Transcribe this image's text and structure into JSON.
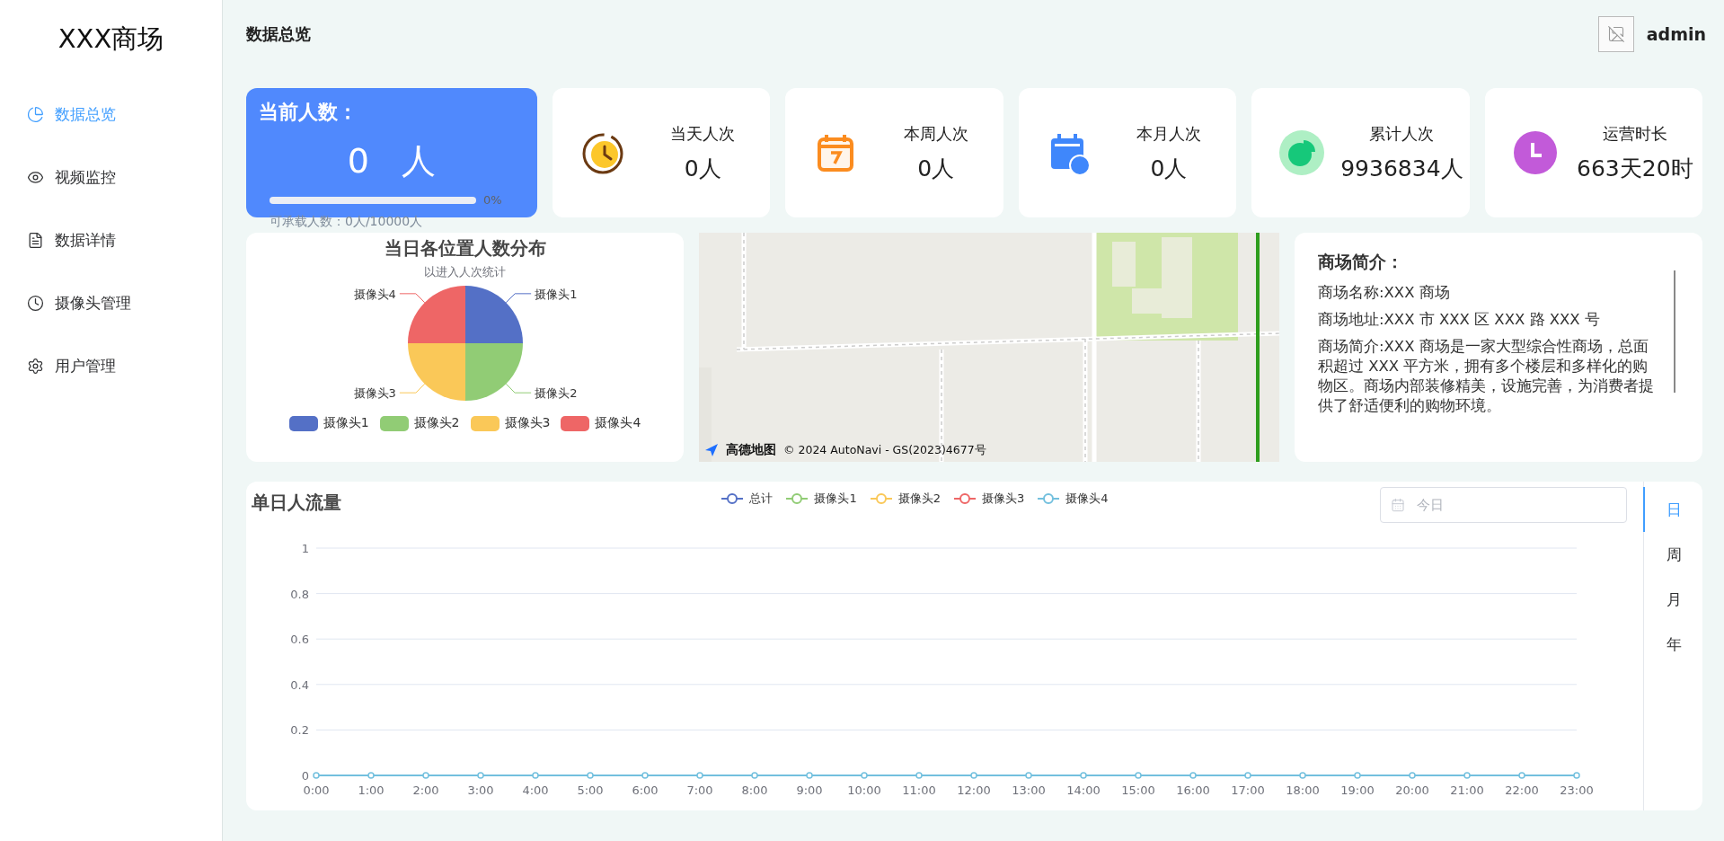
{
  "sidebar": {
    "logo": "XXX商场",
    "items": [
      {
        "label": "数据总览",
        "selected": true
      },
      {
        "label": "视频监控",
        "selected": false
      },
      {
        "label": "数据详情",
        "selected": false
      },
      {
        "label": "摄像头管理",
        "selected": false
      },
      {
        "label": "用户管理",
        "selected": false
      }
    ]
  },
  "header": {
    "title": "数据总览",
    "user": "admin"
  },
  "current": {
    "title": "当前人数：",
    "count": "0 人",
    "level": 0,
    "percent": "0%",
    "capacity": "可承载人数：0人/10000人"
  },
  "stats": [
    {
      "label": "当天人次",
      "value": "0人"
    },
    {
      "label": "本周人次",
      "value": "0人"
    },
    {
      "label": "本月人次",
      "value": "0人"
    },
    {
      "label": "累计人次",
      "value": "9936834人"
    },
    {
      "label": "运营时长",
      "value": "663天20时"
    }
  ],
  "distribution": {
    "subtitle": "以进入人次统计",
    "chart_data": {
      "type": "pie",
      "title": "当日各位置人数分布",
      "categories": [
        "摄像头1",
        "摄像头2",
        "摄像头3",
        "摄像头4"
      ],
      "values": [
        1,
        1,
        1,
        1
      ],
      "colors": [
        "#5470c6",
        "#91cc75",
        "#fac858",
        "#ee6666"
      ]
    }
  },
  "map": {
    "brand": "高德地图",
    "attribution": "© 2024 AutoNavi - GS(2023)4677号"
  },
  "intro": {
    "title": "商场简介：",
    "paragraphs": [
      "商场名称:XXX 商场",
      "商场地址:XXX 市 XXX 区 XXX 路 XXX 号",
      "商场简介:XXX 商场是一家大型综合性商场，总面积超过 XXX 平方米，拥有多个楼层和多样化的购物区。商场内部装修精美，设施完善，为消费者提供了舒适便利的购物环境。"
    ]
  },
  "traffic": {
    "title": "单日人流量",
    "date_field": {
      "placeholder": "今日"
    },
    "chart_data": {
      "type": "line",
      "x": [
        "0:00",
        "1:00",
        "2:00",
        "3:00",
        "4:00",
        "5:00",
        "6:00",
        "7:00",
        "8:00",
        "9:00",
        "10:00",
        "11:00",
        "12:00",
        "13:00",
        "14:00",
        "15:00",
        "16:00",
        "17:00",
        "18:00",
        "19:00",
        "20:00",
        "21:00",
        "22:00",
        "23:00"
      ],
      "ylim": [
        0,
        1
      ],
      "grid": true,
      "yticks": [
        0,
        0.2,
        0.4,
        0.6,
        0.8,
        1
      ],
      "series": [
        {
          "name": "总计",
          "color": "#5470c6",
          "marker": true,
          "values": [
            null,
            null,
            null,
            null,
            null,
            null,
            null,
            null,
            null,
            null,
            null,
            null,
            null,
            null,
            null,
            null,
            null,
            null,
            null,
            null,
            null,
            null,
            null,
            null
          ]
        },
        {
          "name": "摄像头1",
          "color": "#91cc75",
          "marker": true,
          "values": [
            null,
            null,
            null,
            null,
            null,
            null,
            null,
            null,
            null,
            null,
            null,
            null,
            null,
            null,
            null,
            null,
            null,
            null,
            null,
            null,
            null,
            null,
            null,
            null
          ]
        },
        {
          "name": "摄像头2",
          "color": "#fac858",
          "marker": true,
          "values": [
            null,
            null,
            null,
            null,
            null,
            null,
            null,
            null,
            null,
            null,
            null,
            null,
            null,
            null,
            null,
            null,
            null,
            null,
            null,
            null,
            null,
            null,
            null,
            null
          ]
        },
        {
          "name": "摄像头3",
          "color": "#ee6666",
          "marker": true,
          "values": [
            null,
            null,
            null,
            null,
            null,
            null,
            null,
            null,
            null,
            null,
            null,
            null,
            null,
            null,
            null,
            null,
            null,
            null,
            null,
            null,
            null,
            null,
            null,
            null
          ]
        },
        {
          "name": "摄像头4",
          "color": "#73c0de",
          "marker": true,
          "values": [
            0,
            0,
            0,
            0,
            0,
            0,
            0,
            0,
            0,
            0,
            0,
            0,
            0,
            0,
            0,
            0,
            0,
            0,
            0,
            0,
            0,
            0,
            0,
            0
          ]
        }
      ]
    },
    "tabs": [
      {
        "label": "日",
        "selected": true
      },
      {
        "label": "周",
        "selected": false
      },
      {
        "label": "月",
        "selected": false
      },
      {
        "label": "年",
        "selected": false
      }
    ]
  }
}
